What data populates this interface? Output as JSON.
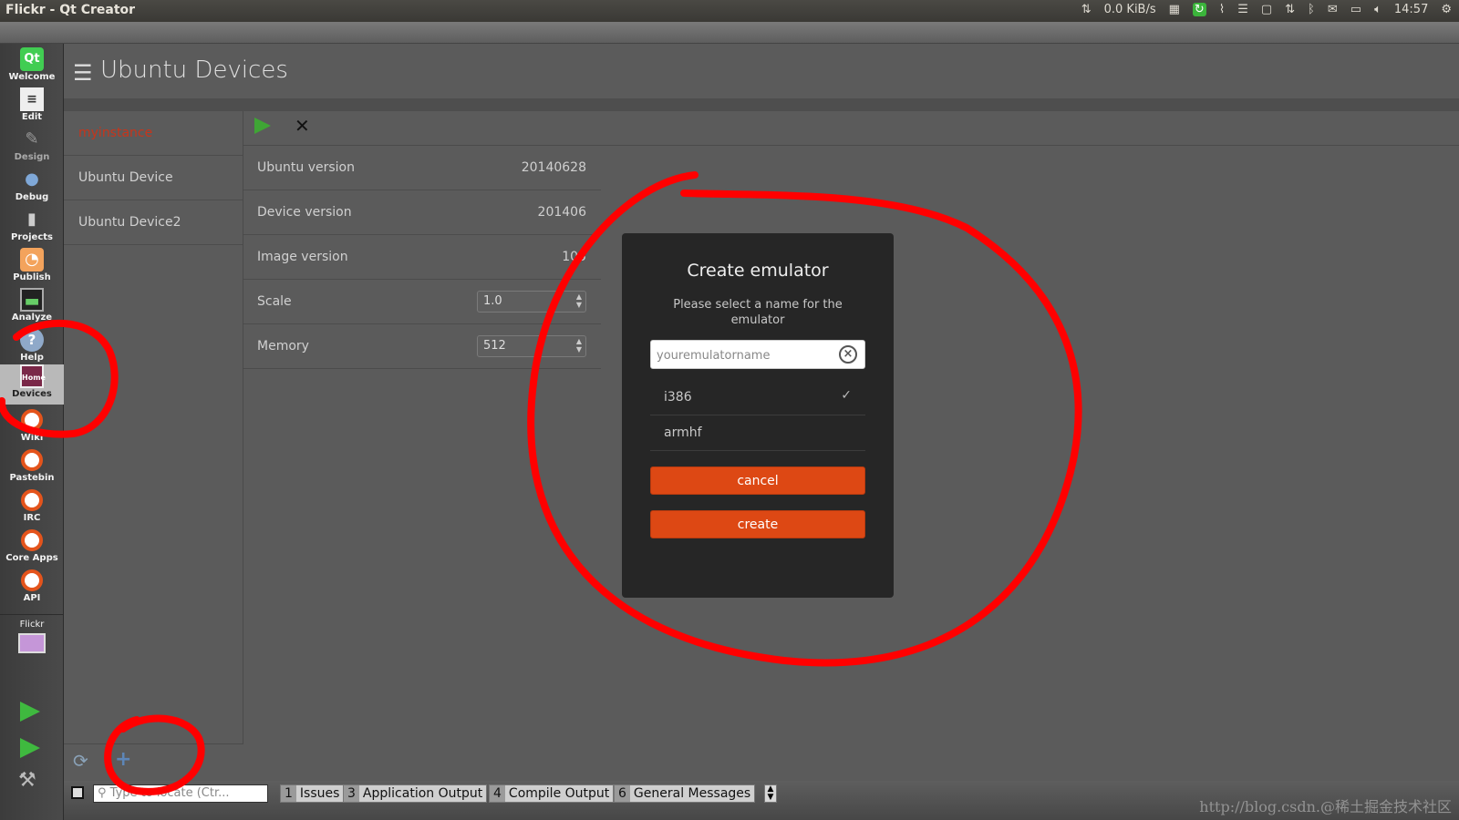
{
  "window": {
    "title": "Flickr - Qt Creator"
  },
  "tray": {
    "net_speed": "0.0 KiB/s",
    "time": "14:57"
  },
  "modebar": {
    "items": [
      {
        "label": "Welcome",
        "icon": "qt-logo-icon"
      },
      {
        "label": "Edit",
        "icon": "edit-document-icon"
      },
      {
        "label": "Design",
        "icon": "design-pencil-icon"
      },
      {
        "label": "Debug",
        "icon": "debug-bug-icon"
      },
      {
        "label": "Projects",
        "icon": "projects-wrench-icon"
      },
      {
        "label": "Publish",
        "icon": "publish-icon"
      },
      {
        "label": "Analyze",
        "icon": "analyze-monitor-icon"
      },
      {
        "label": "Help",
        "icon": "help-question-icon"
      },
      {
        "label": "Devices",
        "icon": "devices-icon"
      },
      {
        "label": "Wiki",
        "icon": "ubuntu-icon"
      },
      {
        "label": "Pastebin",
        "icon": "ubuntu-icon"
      },
      {
        "label": "IRC",
        "icon": "ubuntu-icon"
      },
      {
        "label": "Core Apps",
        "icon": "ubuntu-icon"
      },
      {
        "label": "API",
        "icon": "ubuntu-icon"
      }
    ],
    "project": "Flickr"
  },
  "header": {
    "title": "Ubuntu Devices"
  },
  "devices": [
    {
      "name": "myinstance",
      "selected": true
    },
    {
      "name": "Ubuntu Device",
      "selected": false
    },
    {
      "name": "Ubuntu Device2",
      "selected": false
    }
  ],
  "details": {
    "ubuntu_version_label": "Ubuntu version",
    "ubuntu_version_value": "20140628",
    "device_version_label": "Device version",
    "device_version_value": "201406",
    "image_version_label": "Image version",
    "image_version_value": "105",
    "scale_label": "Scale",
    "scale_value": "1.0",
    "memory_label": "Memory",
    "memory_value": "512"
  },
  "dialog": {
    "title": "Create emulator",
    "description": "Please select a name for the emulator",
    "name_placeholder": "youremulatorname",
    "options": [
      {
        "label": "i386",
        "checked": true
      },
      {
        "label": "armhf",
        "checked": false
      }
    ],
    "cancel_label": "cancel",
    "create_label": "create"
  },
  "bottombar": {
    "locator_placeholder": "Type to locate (Ctr...",
    "tabs": [
      {
        "num": "1",
        "label": "Issues"
      },
      {
        "num": "3",
        "label": "Application Output"
      },
      {
        "num": "4",
        "label": "Compile Output"
      },
      {
        "num": "6",
        "label": "General Messages"
      }
    ]
  },
  "watermark": "http://blog.csdn.@稀土掘金技术社区",
  "colors": {
    "accent": "#dd4814",
    "annotation": "#ff0000",
    "selected_device": "#c7351b"
  }
}
